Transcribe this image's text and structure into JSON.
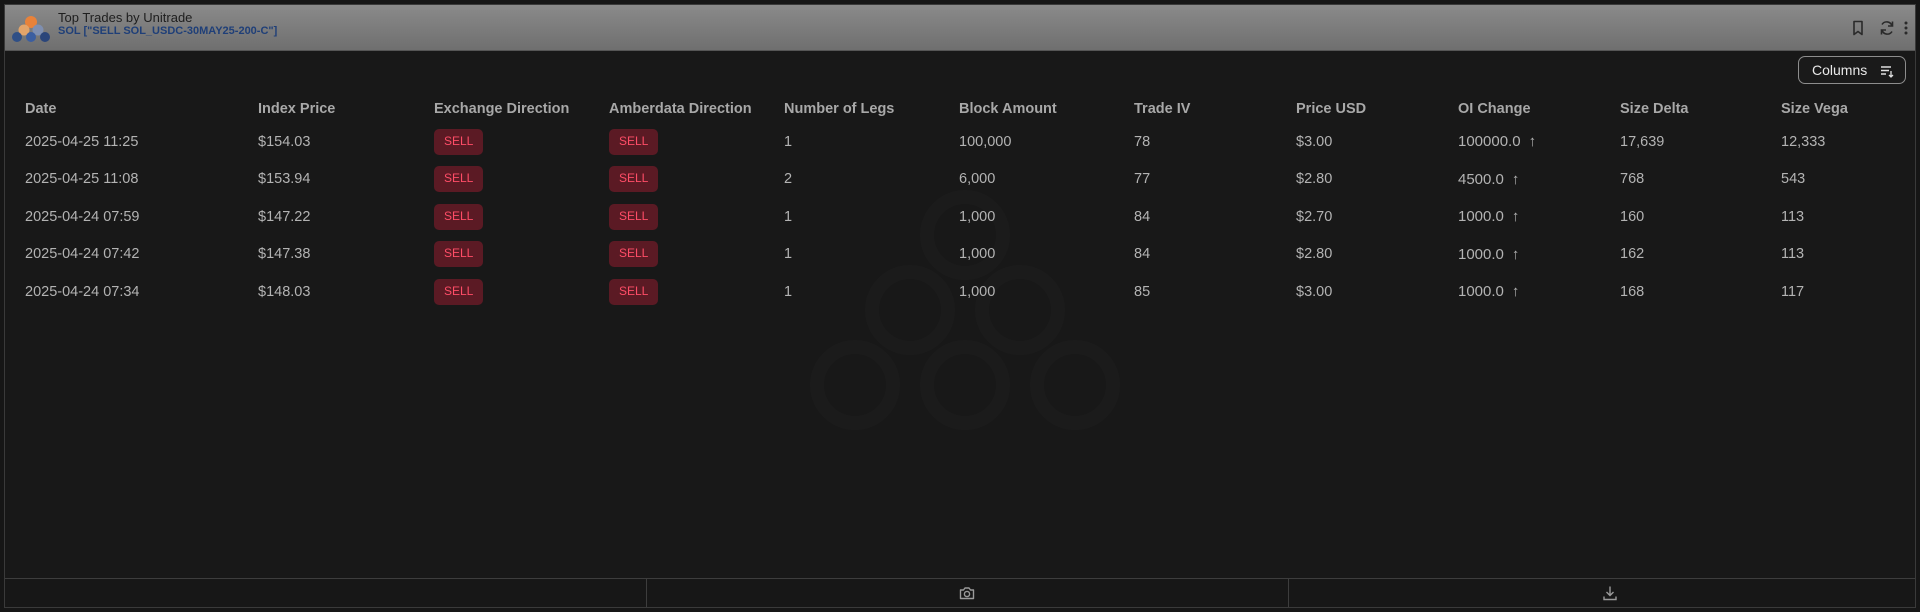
{
  "window": {
    "title": "Top Trades by Unitrade",
    "subtitle": "SOL [\"SELL SOL_USDC-30MAY25-200-C\"]",
    "icons": [
      "bookmark-icon",
      "refresh-icon",
      "more-vertical-icon"
    ]
  },
  "toolbar": {
    "columns_label": "Columns",
    "columns_icon": "columns-filter-icon"
  },
  "table": {
    "columns": [
      "Date",
      "Index Price",
      "Exchange Direction",
      "Amberdata Direction",
      "Number of Legs",
      "Block Amount",
      "Trade IV",
      "Price USD",
      "OI Change",
      "Size Delta",
      "Size Vega"
    ],
    "rows": [
      {
        "date": "2025-04-25 11:25",
        "index_price": "$154.03",
        "exchange_direction": "SELL",
        "amberdata_direction": "SELL",
        "legs": "1",
        "block_amount": "100,000",
        "trade_iv": "78",
        "price_usd": "$3.00",
        "oi_change": "100000.0",
        "size_delta": "17,639",
        "size_vega": "12,333"
      },
      {
        "date": "2025-04-25 11:08",
        "index_price": "$153.94",
        "exchange_direction": "SELL",
        "amberdata_direction": "SELL",
        "legs": "2",
        "block_amount": "6,000",
        "trade_iv": "77",
        "price_usd": "$2.80",
        "oi_change": "4500.0",
        "size_delta": "768",
        "size_vega": "543"
      },
      {
        "date": "2025-04-24 07:59",
        "index_price": "$147.22",
        "exchange_direction": "SELL",
        "amberdata_direction": "SELL",
        "legs": "1",
        "block_amount": "1,000",
        "trade_iv": "84",
        "price_usd": "$2.70",
        "oi_change": "1000.0",
        "size_delta": "160",
        "size_vega": "113"
      },
      {
        "date": "2025-04-24 07:42",
        "index_price": "$147.38",
        "exchange_direction": "SELL",
        "amberdata_direction": "SELL",
        "legs": "1",
        "block_amount": "1,000",
        "trade_iv": "84",
        "price_usd": "$2.80",
        "oi_change": "1000.0",
        "size_delta": "162",
        "size_vega": "113"
      },
      {
        "date": "2025-04-24 07:34",
        "index_price": "$148.03",
        "exchange_direction": "SELL",
        "amberdata_direction": "SELL",
        "legs": "1",
        "block_amount": "1,000",
        "trade_iv": "85",
        "price_usd": "$3.00",
        "oi_change": "1000.0",
        "size_delta": "168",
        "size_vega": "117"
      }
    ],
    "oi_arrow": "↑"
  },
  "footer": {
    "icons": [
      "camera-icon",
      "download-icon"
    ]
  },
  "colors": {
    "sell_text": "#ff4d67",
    "sell_bg": "#5b1a24",
    "oi_positive": "#2fd06a",
    "subtitle": "#1f3f78"
  }
}
